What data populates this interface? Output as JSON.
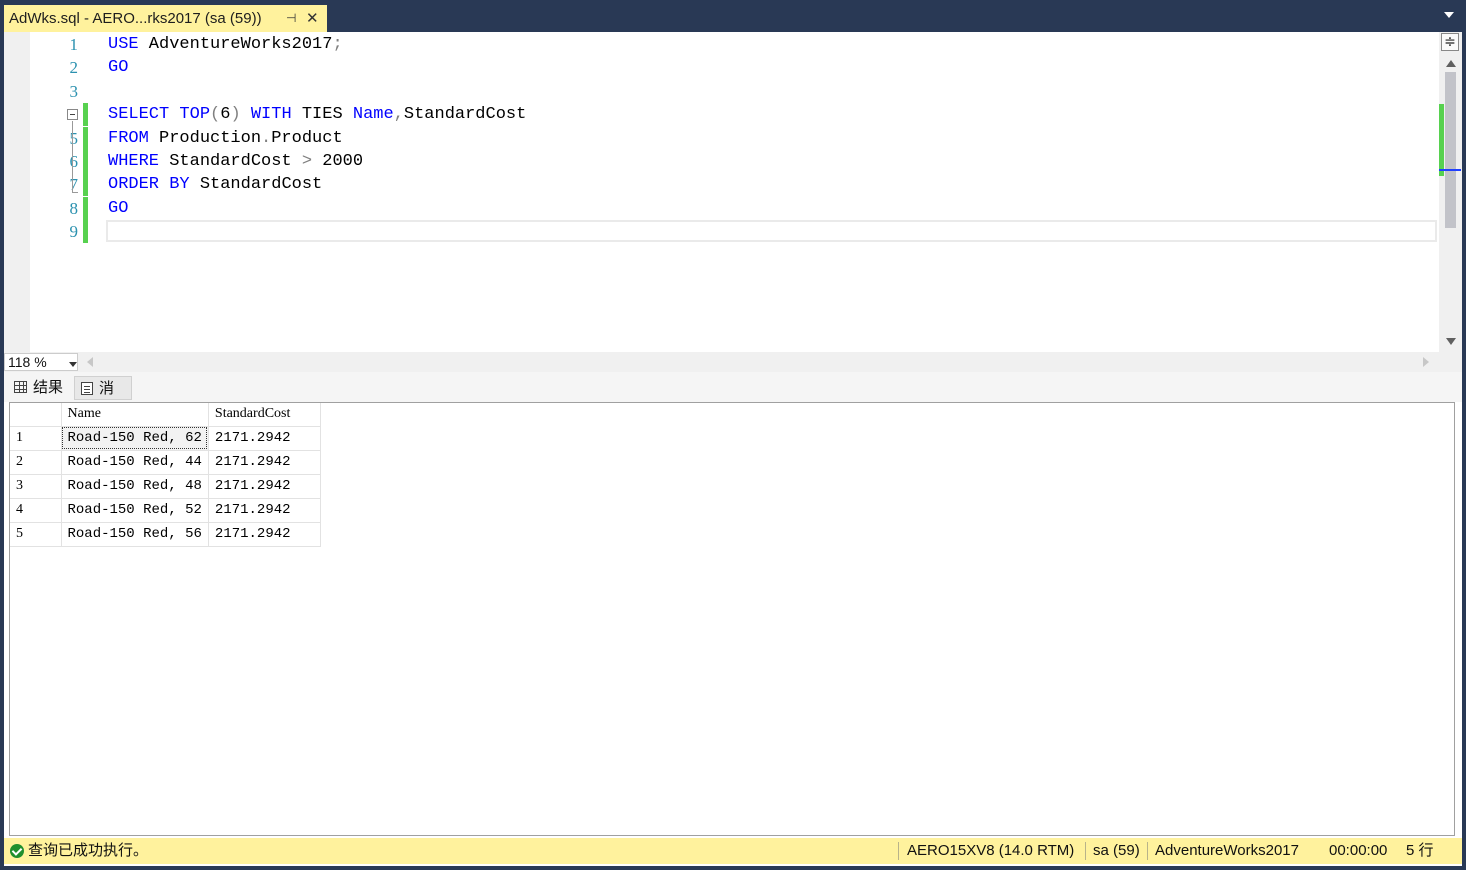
{
  "tab": {
    "title": "AdWks.sql - AERO...rks2017 (sa (59))",
    "pin_glyph": "⊣",
    "close_glyph": "✕"
  },
  "editor": {
    "line_numbers": [
      "1",
      "2",
      "3",
      "4",
      "5",
      "6",
      "7",
      "8",
      "9"
    ],
    "lines": [
      [
        {
          "t": "USE",
          "c": "kw"
        },
        {
          "t": " AdventureWorks2017",
          "c": "txt"
        },
        {
          "t": ";",
          "c": "gray"
        }
      ],
      [
        {
          "t": "GO",
          "c": "kw"
        }
      ],
      [],
      [
        {
          "t": "SELECT",
          "c": "kw"
        },
        {
          "t": " ",
          "c": "txt"
        },
        {
          "t": "TOP",
          "c": "kw"
        },
        {
          "t": "(",
          "c": "gray"
        },
        {
          "t": "6",
          "c": "txt"
        },
        {
          "t": ")",
          "c": "gray"
        },
        {
          "t": " ",
          "c": "txt"
        },
        {
          "t": "WITH",
          "c": "kw"
        },
        {
          "t": " TIES ",
          "c": "txt"
        },
        {
          "t": "Name",
          "c": "cyanname"
        },
        {
          "t": ",",
          "c": "gray"
        },
        {
          "t": "StandardCost",
          "c": "txt"
        }
      ],
      [
        {
          "t": "FROM",
          "c": "kw"
        },
        {
          "t": " Production",
          "c": "txt"
        },
        {
          "t": ".",
          "c": "gray"
        },
        {
          "t": "Product",
          "c": "txt"
        }
      ],
      [
        {
          "t": "WHERE",
          "c": "kw"
        },
        {
          "t": " StandardCost ",
          "c": "txt"
        },
        {
          "t": ">",
          "c": "gray"
        },
        {
          "t": " 2000",
          "c": "txt"
        }
      ],
      [
        {
          "t": "ORDER",
          "c": "kw"
        },
        {
          "t": " ",
          "c": "txt"
        },
        {
          "t": "BY",
          "c": "kw"
        },
        {
          "t": " StandardCost",
          "c": "txt"
        }
      ],
      [
        {
          "t": "GO",
          "c": "kw"
        }
      ],
      []
    ],
    "changed_lines": [
      4,
      5,
      6,
      7,
      8,
      9
    ]
  },
  "zoom": {
    "value": "118 %"
  },
  "result_tabs": {
    "results_label": "结果",
    "messages_label": "消息"
  },
  "grid": {
    "columns": [
      "Name",
      "StandardCost"
    ],
    "rows": [
      {
        "num": "1",
        "name": "Road-150 Red, 62",
        "cost": "2171.2942"
      },
      {
        "num": "2",
        "name": "Road-150 Red, 44",
        "cost": "2171.2942"
      },
      {
        "num": "3",
        "name": "Road-150 Red, 48",
        "cost": "2171.2942"
      },
      {
        "num": "4",
        "name": "Road-150 Red, 52",
        "cost": "2171.2942"
      },
      {
        "num": "5",
        "name": "Road-150 Red, 56",
        "cost": "2171.2942"
      }
    ]
  },
  "status": {
    "message": "查询已成功执行。",
    "server": "AERO15XV8 (14.0 RTM)",
    "user": "sa (59)",
    "database": "AdventureWorks2017",
    "elapsed": "00:00:00",
    "row_count": "5 行"
  },
  "colors": {
    "accent_yellow": "#fff29d",
    "chrome_dark": "#293955",
    "change_green": "#57d14f",
    "keyword_blue": "#0000ff"
  }
}
